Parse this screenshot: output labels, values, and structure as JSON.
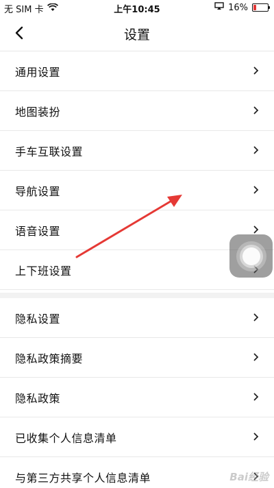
{
  "status_bar": {
    "carrier": "无 SIM 卡",
    "time": "上午10:45",
    "battery_percent": "16%",
    "battery_level": 0.16,
    "wifi_icon": "wifi-icon",
    "airplay_icon": "screen-mirror-icon"
  },
  "nav": {
    "title": "设置",
    "back_icon": "chevron-left-icon"
  },
  "group1": [
    {
      "label": "通用设置"
    },
    {
      "label": "地图装扮"
    },
    {
      "label": "手车互联设置"
    },
    {
      "label": "导航设置"
    },
    {
      "label": "语音设置"
    },
    {
      "label": "上下班设置"
    }
  ],
  "group2": [
    {
      "label": "隐私设置"
    },
    {
      "label": "隐私政策摘要"
    },
    {
      "label": "隐私政策"
    },
    {
      "label": "已收集个人信息清单"
    },
    {
      "label": "与第三方共享个人信息清单"
    }
  ],
  "watermark": "Bai经验",
  "colors": {
    "annotation_arrow": "#e53935",
    "battery_low": "#e23636",
    "divider": "#e8e8e8"
  }
}
